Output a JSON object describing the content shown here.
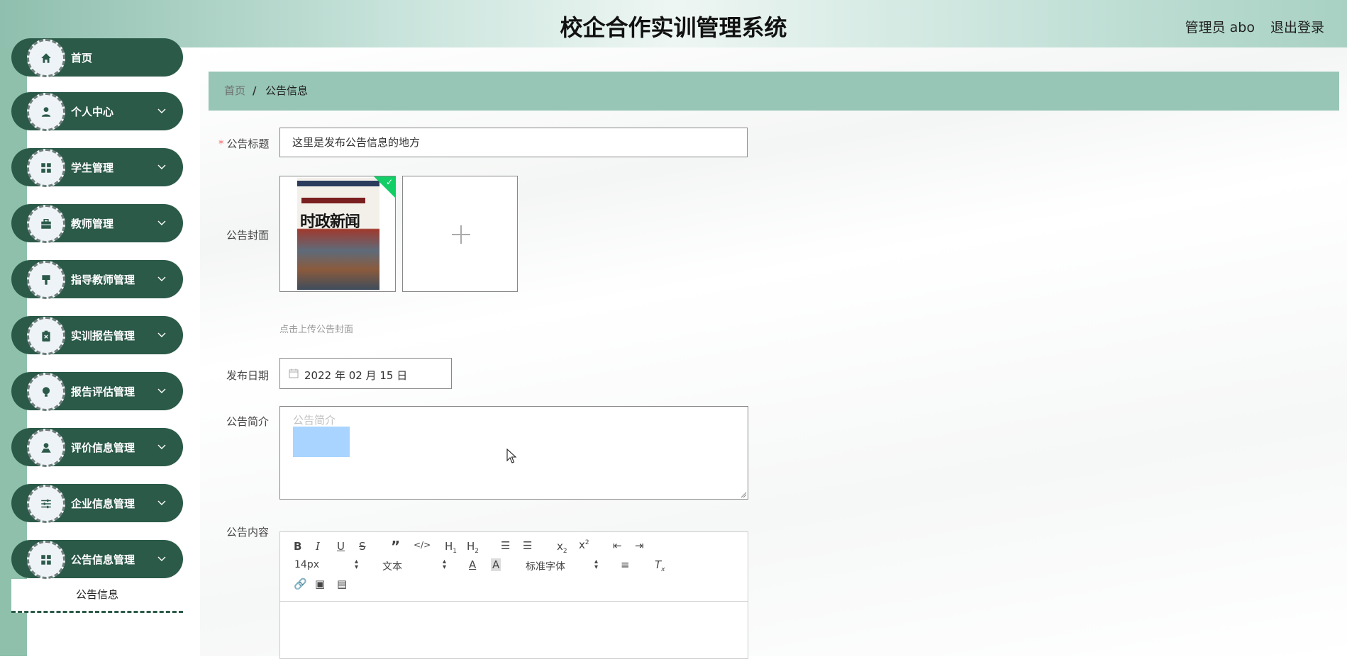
{
  "header": {
    "title": "校企合作实训管理系统",
    "user": "管理员 abo",
    "logout": "退出登录"
  },
  "sidebar": {
    "items": [
      {
        "label": "首页",
        "icon": "home-icon"
      },
      {
        "label": "个人中心",
        "icon": "user-icon"
      },
      {
        "label": "学生管理",
        "icon": "grid-icon"
      },
      {
        "label": "教师管理",
        "icon": "briefcase-icon"
      },
      {
        "label": "指导教师管理",
        "icon": "brush-icon"
      },
      {
        "label": "实训报告管理",
        "icon": "clipboard-icon"
      },
      {
        "label": "报告评估管理",
        "icon": "bulb-icon"
      },
      {
        "label": "评价信息管理",
        "icon": "person-icon"
      },
      {
        "label": "企业信息管理",
        "icon": "sliders-icon"
      },
      {
        "label": "公告信息管理",
        "icon": "grid-icon"
      }
    ],
    "submenu": "公告信息"
  },
  "breadcrumb": {
    "home": "首页",
    "separator": "/",
    "current": "公告信息"
  },
  "form": {
    "title_label": "公告标题",
    "title_value": "这里是发布公告信息的地方",
    "cover_label": "公告封面",
    "cover_text": "时政新闻",
    "upload_tip": "点击上传公告封面",
    "date_label": "发布日期",
    "date_value": "2022 年 02 月 15 日",
    "intro_label": "公告简介",
    "intro_placeholder": "公告简介",
    "content_label": "公告内容"
  },
  "editor": {
    "font_size": "14px",
    "block_type": "文本",
    "font_family": "标准字体"
  },
  "colors": {
    "sidebar_item": "#2b5a49",
    "breadcrumb_bg": "#97c5b6",
    "strip": "#8ec0ac"
  }
}
